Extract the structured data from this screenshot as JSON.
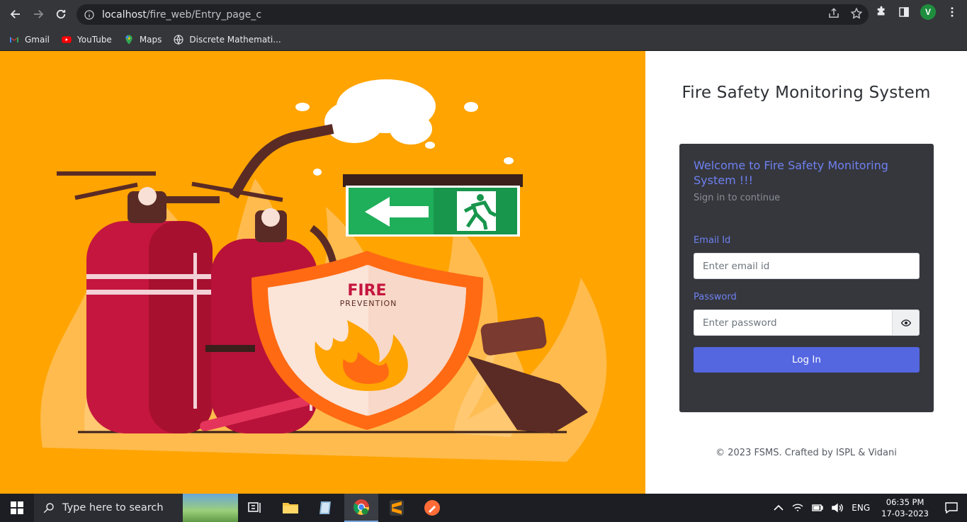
{
  "browser": {
    "url_host": "localhost",
    "url_path": "/fire_web/Entry_page_c",
    "profile_initial": "V",
    "bookmarks": [
      {
        "label": "Gmail",
        "icon": "gmail-icon"
      },
      {
        "label": "YouTube",
        "icon": "youtube-icon"
      },
      {
        "label": "Maps",
        "icon": "maps-icon"
      },
      {
        "label": "Discrete Mathemati...",
        "icon": "site-icon"
      }
    ]
  },
  "hero": {
    "shield_title": "FIRE",
    "shield_subtitle": "PREVENTION",
    "colors": {
      "background": "#ffa400",
      "extinguisher": "#c5163f",
      "shield": "#ff6a13",
      "exit_sign": "#1fae5a"
    }
  },
  "login": {
    "system_title": "Fire Safety Monitoring System",
    "welcome": "Welcome to Fire Safety Monitoring System !!!",
    "subtitle": "Sign in to continue",
    "email_label": "Email Id",
    "email_placeholder": "Enter email id",
    "password_label": "Password",
    "password_placeholder": "Enter password",
    "login_button": "Log In",
    "footer": "© 2023 FSMS. Crafted by ISPL & Vidani",
    "accent": "#5466e0"
  },
  "taskbar": {
    "search_placeholder": "Type here to search",
    "language": "ENG",
    "time": "06:35 PM",
    "date": "17-03-2023"
  }
}
